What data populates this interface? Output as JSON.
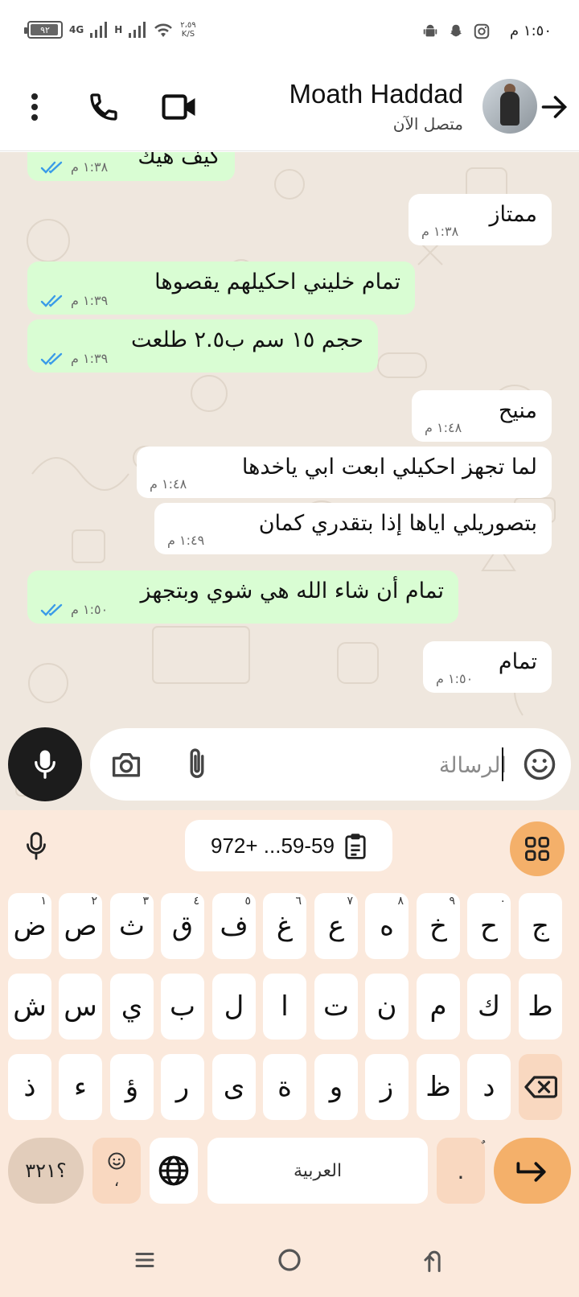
{
  "status_bar": {
    "time": "١:٥٠ م",
    "battery": "٩٢",
    "network1": "4G",
    "network2": "H",
    "speed_value": "٢،٥٩",
    "speed_unit": "K/S",
    "app_icons": [
      "android-icon",
      "snapchat-icon",
      "instagram-icon"
    ]
  },
  "header": {
    "contact_name": "Moath Haddad",
    "status": "متصل الآن"
  },
  "messages": [
    {
      "dir": "out",
      "text": "كيف هيك",
      "time": "١:٣٨ م",
      "ticks": true
    },
    {
      "dir": "in",
      "text": "ممتاز",
      "time": "١:٣٨ م"
    },
    {
      "dir": "out",
      "text": "تمام خليني احكيلهم يقصوها",
      "time": "١:٣٩ م",
      "ticks": true
    },
    {
      "dir": "out",
      "text": "حجم ١٥ سم ب٢.٥ طلعت",
      "time": "١:٣٩ م",
      "ticks": true
    },
    {
      "dir": "in",
      "text": "منيح",
      "time": "١:٤٨ م"
    },
    {
      "dir": "in",
      "text": "لما تجهز احكيلي ابعت ابي ياخدها",
      "time": "١:٤٨ م"
    },
    {
      "dir": "in",
      "text": "بتصوريلي اياها إذا بتقدري كمان",
      "time": "١:٤٩ م"
    },
    {
      "dir": "out",
      "text": "تمام أن شاء الله هي شوي وبتجهز",
      "time": "١:٥٠ م",
      "ticks": true
    },
    {
      "dir": "in",
      "text": "تمام",
      "time": "١:٥٠ م"
    }
  ],
  "composer": {
    "placeholder": "الرسالة"
  },
  "keyboard": {
    "clipboard_text": "972+ ...59-59",
    "row1": [
      {
        "ch": "ض",
        "hint": "١"
      },
      {
        "ch": "ص",
        "hint": "٢"
      },
      {
        "ch": "ث",
        "hint": "٣"
      },
      {
        "ch": "ق",
        "hint": "٤"
      },
      {
        "ch": "ف",
        "hint": "٥"
      },
      {
        "ch": "غ",
        "hint": "٦"
      },
      {
        "ch": "ع",
        "hint": "٧"
      },
      {
        "ch": "ه",
        "hint": "٨"
      },
      {
        "ch": "خ",
        "hint": "٩"
      },
      {
        "ch": "ح",
        "hint": "٠"
      },
      {
        "ch": "ج",
        "hint": ""
      }
    ],
    "row2": [
      "ش",
      "س",
      "ي",
      "ب",
      "ل",
      "ا",
      "ت",
      "ن",
      "م",
      "ك",
      "ط"
    ],
    "row3": [
      "ذ",
      "ء",
      "ؤ",
      "ر",
      "ى",
      "ة",
      "و",
      "ز",
      "ظ",
      "د"
    ],
    "symbols_label": "؟٣٢١",
    "emoji_sub": "،",
    "space_label": "العربية",
    "dot_label": ".",
    "dot_hint": "ٌ"
  }
}
